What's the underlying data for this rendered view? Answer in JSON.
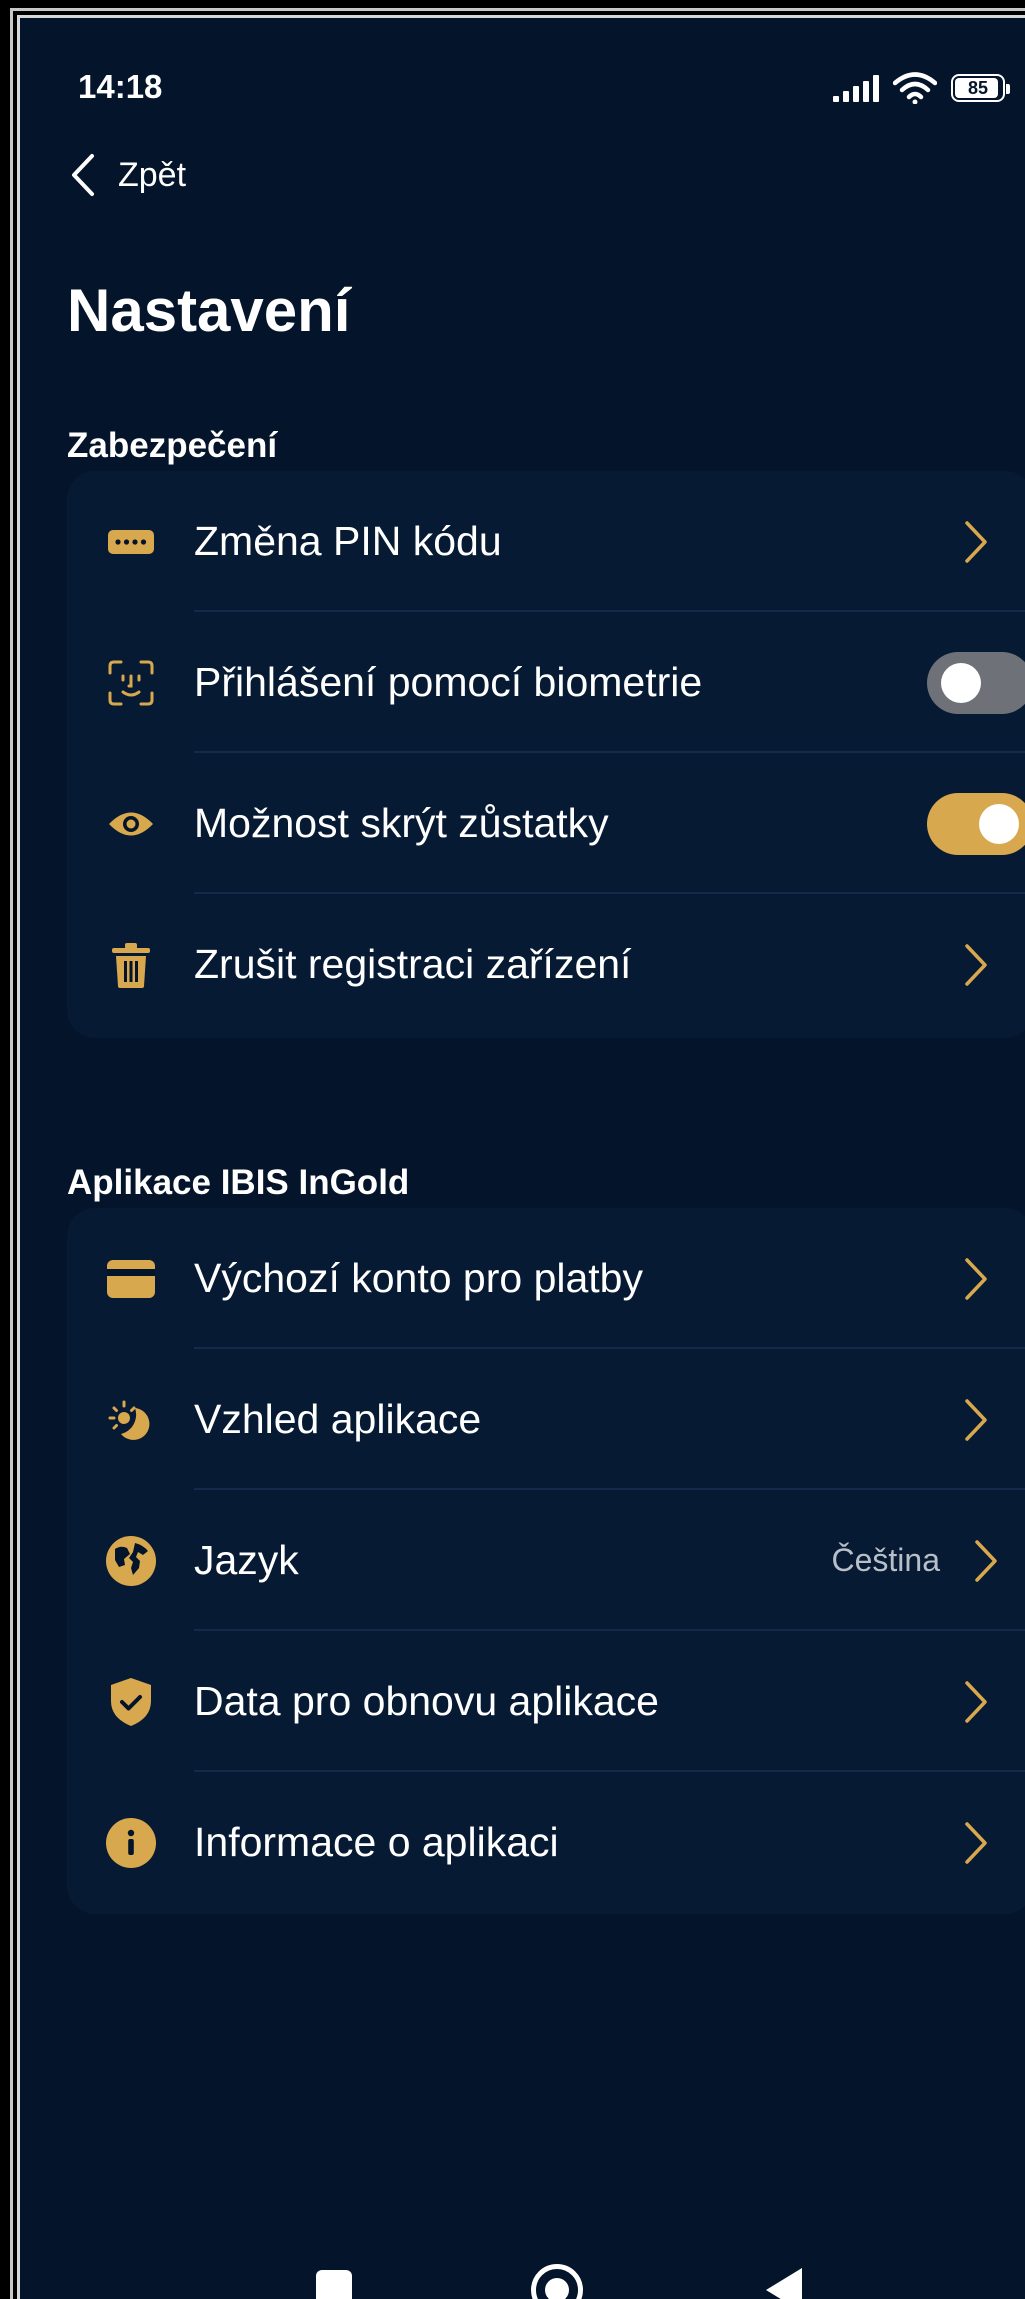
{
  "status": {
    "time": "14:18",
    "battery": "85"
  },
  "header": {
    "back_label": "Zpět",
    "title": "Nastavení"
  },
  "colors": {
    "accent": "#d8a84e",
    "background": "#04142a",
    "card": "#071a33",
    "toggle_off": "#6e7278"
  },
  "security": {
    "title": "Zabezpečení",
    "items": [
      {
        "label": "Změna PIN kódu",
        "icon": "pin-keypad-icon",
        "control": "chevron"
      },
      {
        "label": "Přihlášení pomocí biometrie",
        "icon": "face-id-icon",
        "control": "toggle",
        "enabled": false
      },
      {
        "label": "Možnost skrýt zůstatky",
        "icon": "eye-icon",
        "control": "toggle",
        "enabled": true
      },
      {
        "label": "Zrušit registraci zařízení",
        "icon": "trash-icon",
        "control": "chevron"
      }
    ]
  },
  "app": {
    "title": "Aplikace IBIS InGold",
    "items": [
      {
        "label": "Výchozí konto pro platby",
        "icon": "card-icon",
        "control": "chevron"
      },
      {
        "label": "Vzhled aplikace",
        "icon": "theme-icon",
        "control": "chevron"
      },
      {
        "label": "Jazyk",
        "icon": "globe-icon",
        "control": "chevron",
        "value": "Čeština"
      },
      {
        "label": "Data pro obnovu aplikace",
        "icon": "shield-check-icon",
        "control": "chevron"
      },
      {
        "label": "Informace o aplikaci",
        "icon": "info-icon",
        "control": "chevron"
      }
    ]
  }
}
